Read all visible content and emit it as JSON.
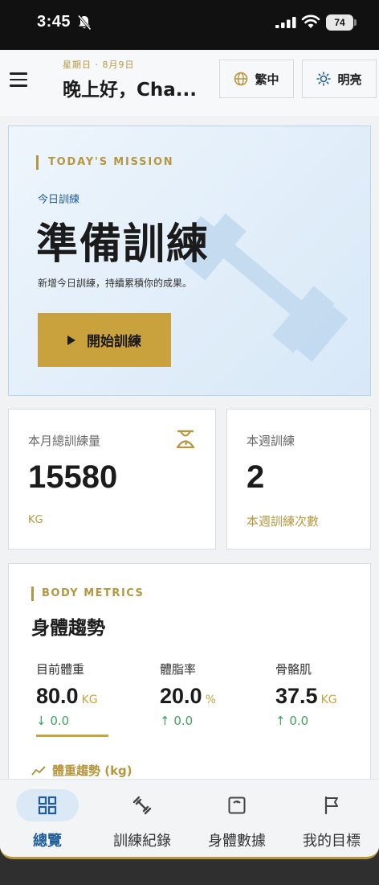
{
  "status_bar": {
    "time": "3:45",
    "battery": "74"
  },
  "header": {
    "date": "星期日 · 8月9日",
    "greeting": "晚上好，Cha...",
    "language_label": "繁中",
    "theme_label": "明亮"
  },
  "mission": {
    "tag": "TODAY'S MISSION",
    "subtitle": "今日訓練",
    "title": "準備訓練",
    "description": "新增今日訓練，持續累積你的成果。",
    "button_label": "開始訓練"
  },
  "monthly_volume": {
    "label": "本月總訓練量",
    "value": "15580",
    "unit": "KG"
  },
  "weekly_training": {
    "label": "本週訓練",
    "value": "2",
    "unit": "本週訓練次數"
  },
  "body_metrics": {
    "tag": "BODY METRICS",
    "title": "身體趨勢",
    "items": [
      {
        "label": "目前體重",
        "value": "80.0",
        "unit": "KG",
        "change": "↓ 0.0"
      },
      {
        "label": "體脂率",
        "value": "20.0",
        "unit": "%",
        "change": "↑ 0.0"
      },
      {
        "label": "骨骼肌",
        "value": "37.5",
        "unit": "KG",
        "change": "↑ 0.0"
      }
    ],
    "trend_label": "體重趨勢 (kg)"
  },
  "bottom_nav": [
    {
      "label": "總覽",
      "icon": "grid-icon",
      "active": true
    },
    {
      "label": "訓練紀錄",
      "icon": "dumbbell-icon",
      "active": false
    },
    {
      "label": "身體數據",
      "icon": "scale-icon",
      "active": false
    },
    {
      "label": "我的目標",
      "icon": "flag-icon",
      "active": false
    }
  ],
  "colors": {
    "accent_gold": "#c9a23d",
    "primary_blue": "#1f5d9a",
    "positive_green": "#3fa45a"
  }
}
